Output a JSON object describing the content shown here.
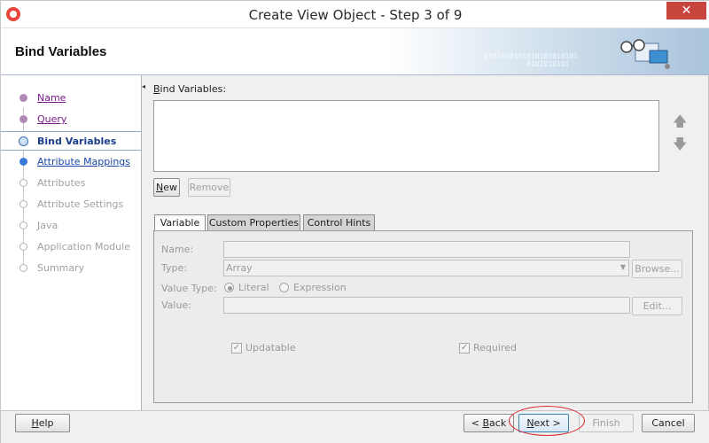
{
  "window": {
    "title": "Create View Object - Step 3 of 9",
    "close_glyph": "✕"
  },
  "header": {
    "title": "Bind Variables",
    "binary_text": "0101010101010101010101\n          0101010101"
  },
  "nav": {
    "items": [
      {
        "label": "Name",
        "state": "done"
      },
      {
        "label": "Query",
        "state": "done"
      },
      {
        "label": "Bind Variables",
        "state": "current"
      },
      {
        "label": "Attribute Mappings",
        "state": "next"
      },
      {
        "label": "Attributes",
        "state": "disabled"
      },
      {
        "label": "Attribute Settings",
        "state": "disabled"
      },
      {
        "label": "Java",
        "state": "disabled"
      },
      {
        "label": "Application Module",
        "state": "disabled"
      },
      {
        "label": "Summary",
        "state": "disabled"
      }
    ]
  },
  "content": {
    "list_label": "Bind Variables:",
    "new_label": "New",
    "remove_label": "Remove",
    "tabs": [
      {
        "label": "Variable",
        "active": true
      },
      {
        "label": "Custom Properties",
        "active": false
      },
      {
        "label": "Control Hints",
        "active": false
      }
    ],
    "form": {
      "name_label": "Name:",
      "name_value": "",
      "type_label": "Type:",
      "type_value": "Array",
      "browse_label": "Browse...",
      "value_type_label": "Value Type:",
      "literal_label": "Literal",
      "expression_label": "Expression",
      "value_label": "Value:",
      "value_value": "",
      "edit_label": "Edit...",
      "updatable_label": "Updatable",
      "required_label": "Required"
    }
  },
  "footer": {
    "help_label": "Help",
    "back_label": "< Back",
    "next_label": "Next >",
    "finish_label": "Finish",
    "cancel_label": "Cancel"
  },
  "colors": {
    "highlight": "#d9262c",
    "current_step": "#1b3f8a",
    "visited_link": "#7a1a8c"
  }
}
